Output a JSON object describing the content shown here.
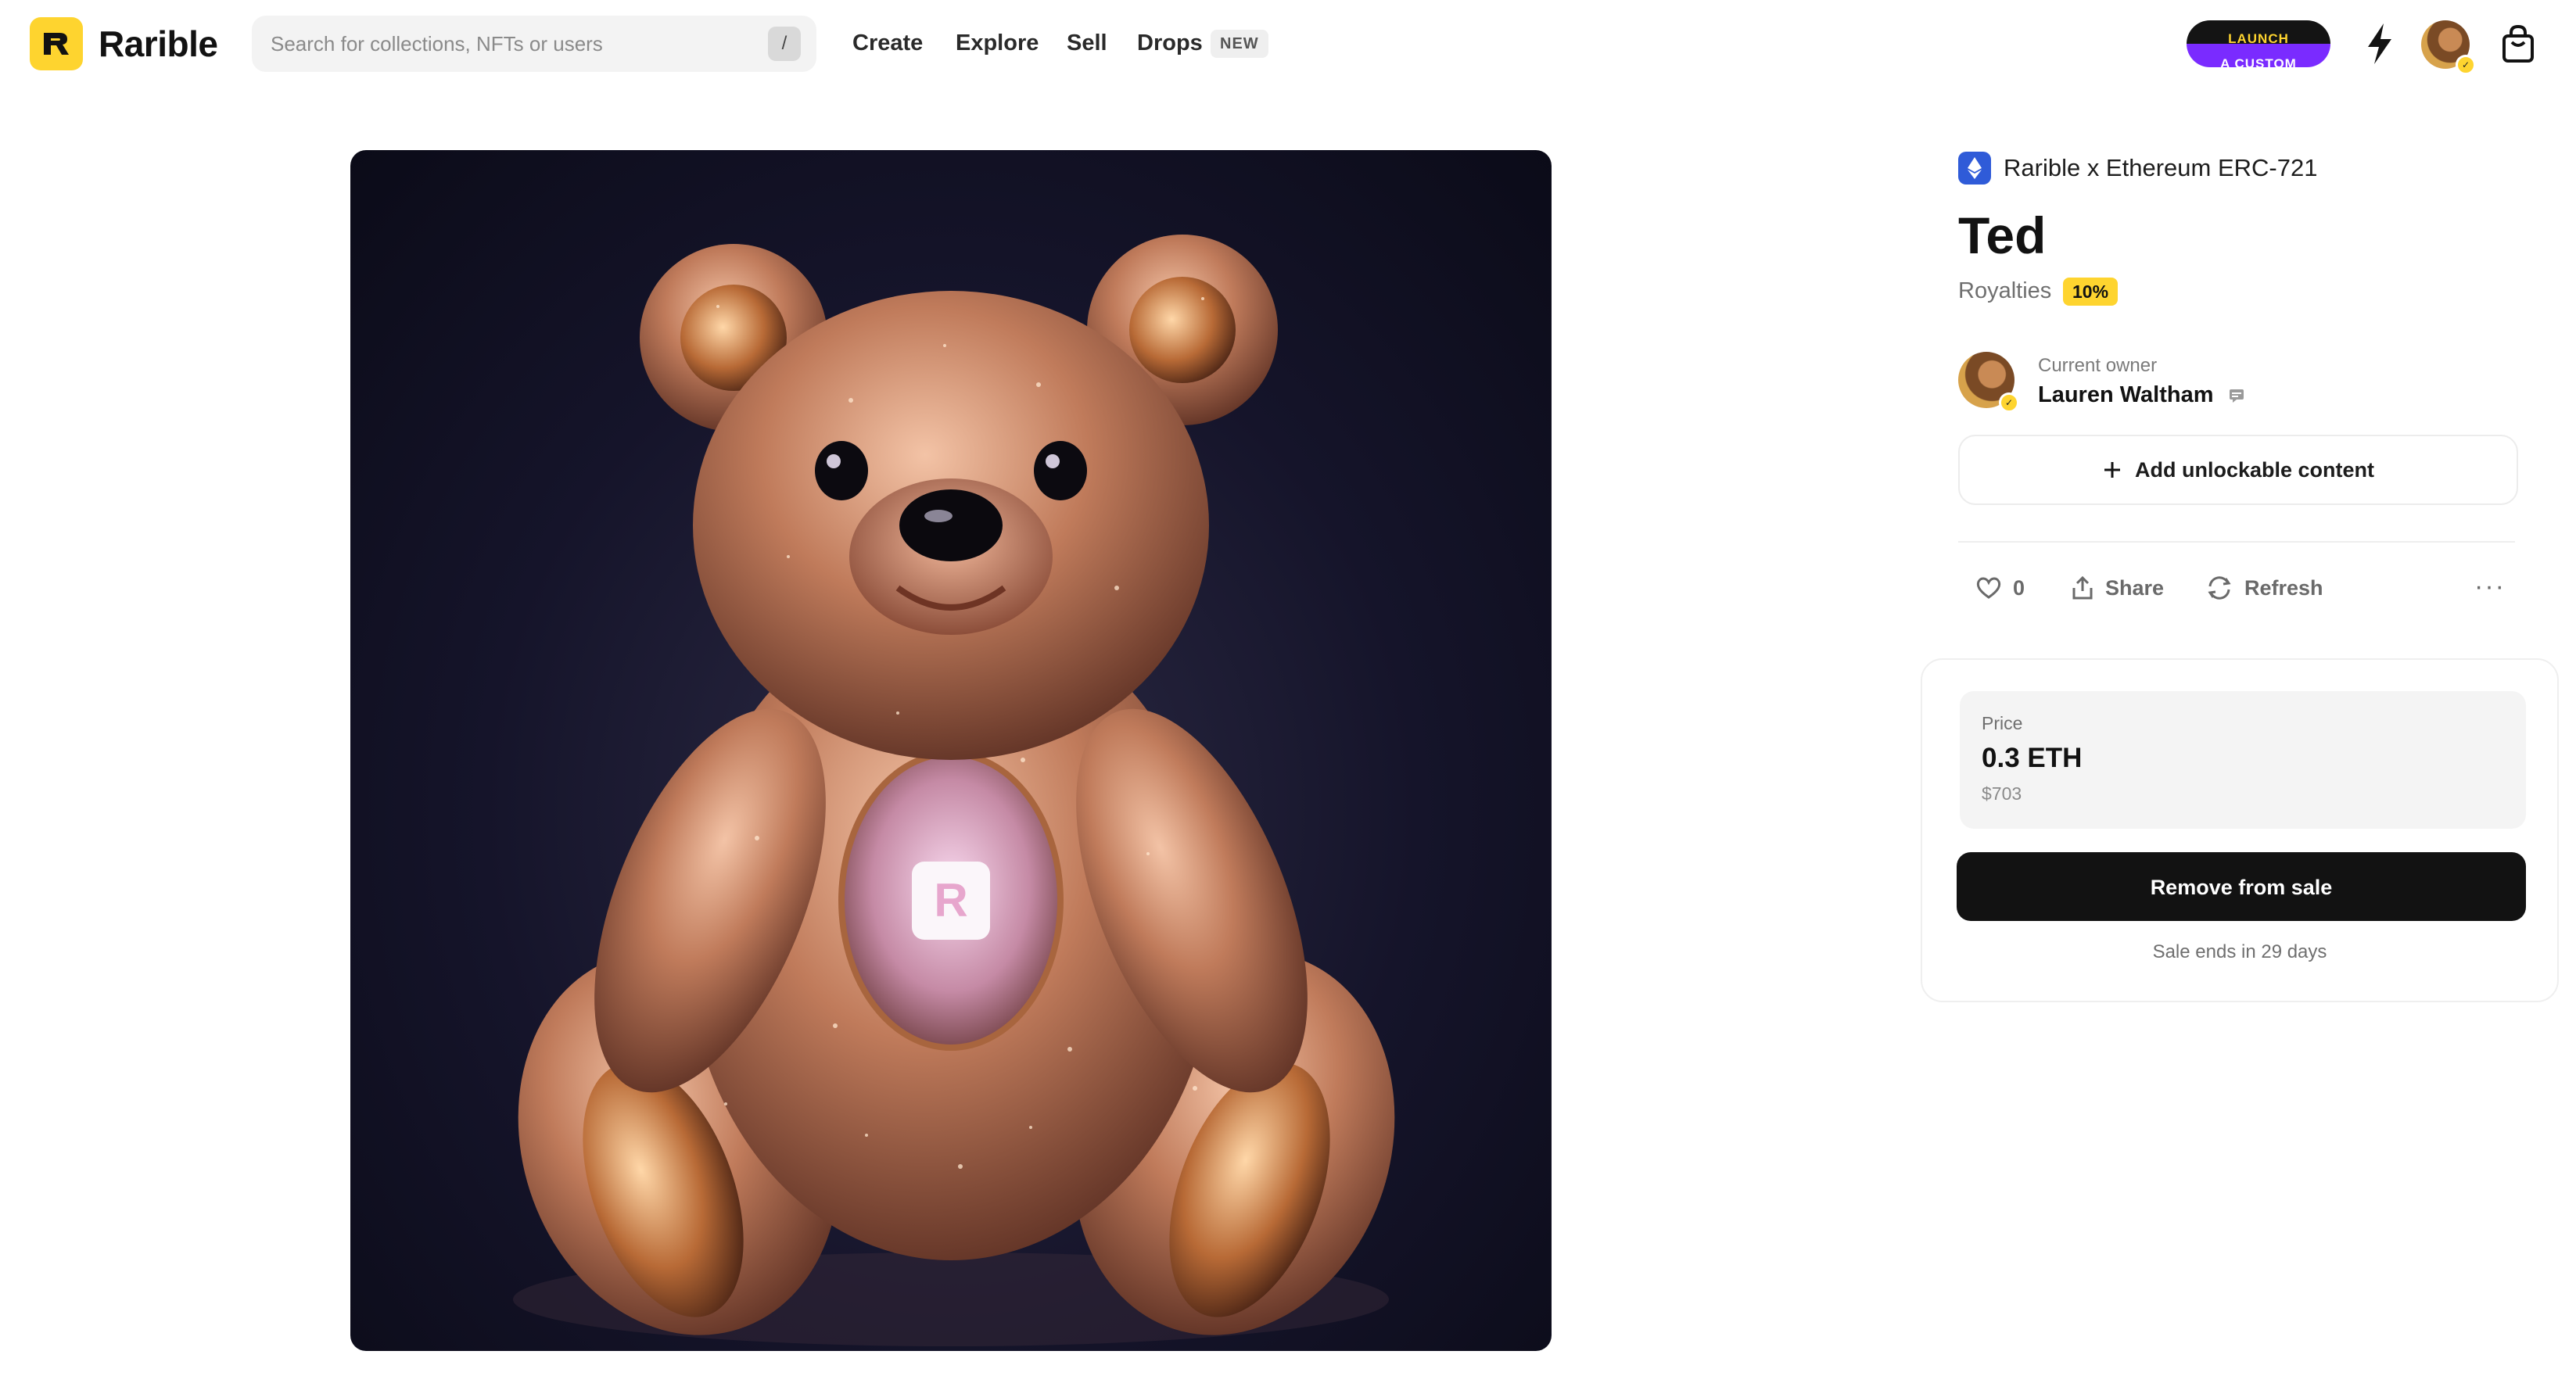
{
  "header": {
    "logo_text": "Rarible",
    "search": {
      "placeholder": "Search for collections, NFTs or users",
      "shortcut": "/"
    },
    "nav": [
      {
        "label": "Create"
      },
      {
        "label": "Explore"
      },
      {
        "label": "Sell"
      },
      {
        "label": "Drops"
      }
    ],
    "drops_badge": "NEW",
    "launch_button": {
      "line1": "LAUNCH",
      "line2": "A CUSTOM"
    },
    "icons": [
      "rarible-logo-icon",
      "lightning-icon",
      "avatar",
      "shopping-bag-icon"
    ]
  },
  "artwork": {
    "logo_badge": "R"
  },
  "item": {
    "chain_label": "Rarible x Ethereum ERC-721",
    "title": "Ted",
    "royalties_label": "Royalties",
    "royalties_value": "10%",
    "owner_caption": "Current owner",
    "owner_name": "Lauren Waltham",
    "unlockable_label": "Add unlockable content",
    "like_count": "0",
    "share_label": "Share",
    "refresh_label": "Refresh",
    "more_label": "···"
  },
  "sale": {
    "price_label": "Price",
    "price_value": "0.3 ETH",
    "price_usd": "$703",
    "remove_button": "Remove from sale",
    "ends_text": "Sale ends in 29 days"
  },
  "colors": {
    "accent_yellow": "#FED42F",
    "dark": "#121212",
    "launch_purple": "#7a2bff",
    "eth_blue": "#2f5bd8"
  }
}
